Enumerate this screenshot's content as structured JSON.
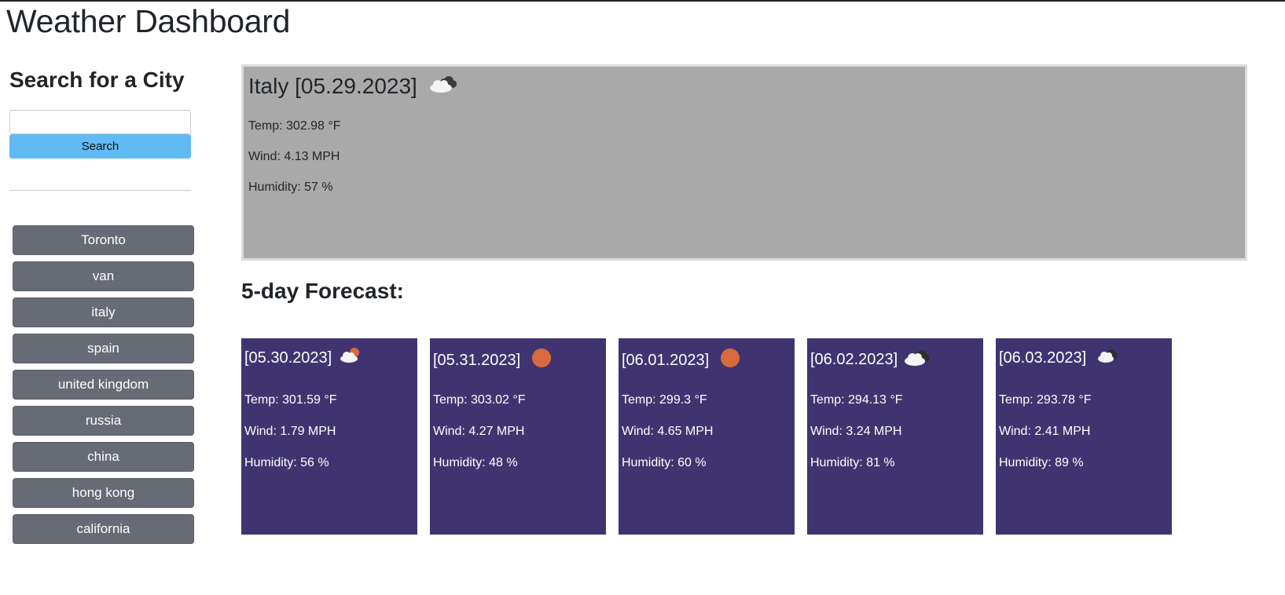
{
  "app": {
    "title": "Weather Dashboard"
  },
  "sidebar": {
    "heading": "Search for a City",
    "search_placeholder": "",
    "search_value": "",
    "search_button": "Search",
    "history": [
      "Toronto",
      "van",
      "italy",
      "spain",
      "united kingdom",
      "russia",
      "china",
      "hong kong",
      "california"
    ]
  },
  "current": {
    "title": "Italy [05.29.2023]",
    "icon": "cloudy-icon",
    "temp": "Temp: 302.98 °F",
    "wind": "Wind: 4.13 MPH",
    "humidity": "Humidity: 57 %"
  },
  "forecast": {
    "heading": "5-day Forecast:",
    "days": [
      {
        "date": "[05.30.2023]",
        "icon": "partly-cloudy-icon",
        "temp": "Temp: 301.59 °F",
        "wind": "Wind: 1.79 MPH",
        "humidity": "Humidity: 56 %"
      },
      {
        "date": "[05.31.2023]",
        "icon": "sun-icon",
        "temp": "Temp: 303.02 °F",
        "wind": "Wind: 4.27 MPH",
        "humidity": "Humidity: 48 %"
      },
      {
        "date": "[06.01.2023]",
        "icon": "sun-icon",
        "temp": "Temp: 299.3 °F",
        "wind": "Wind: 4.65 MPH",
        "humidity": "Humidity: 60 %"
      },
      {
        "date": "[06.02.2023]",
        "icon": "cloudy-icon",
        "temp": "Temp: 294.13 °F",
        "wind": "Wind: 3.24 MPH",
        "humidity": "Humidity: 81 %"
      },
      {
        "date": "[06.03.2023]",
        "icon": "cloudy-icon",
        "temp": "Temp: 293.78 °F",
        "wind": "Wind: 2.41 MPH",
        "humidity": "Humidity: 89 %"
      }
    ]
  },
  "colors": {
    "search_button": "#62baf2",
    "history_button": "#676b75",
    "current_card": "#a9a9a9",
    "forecast_card": "#403470",
    "sun": "#d86a3e"
  }
}
